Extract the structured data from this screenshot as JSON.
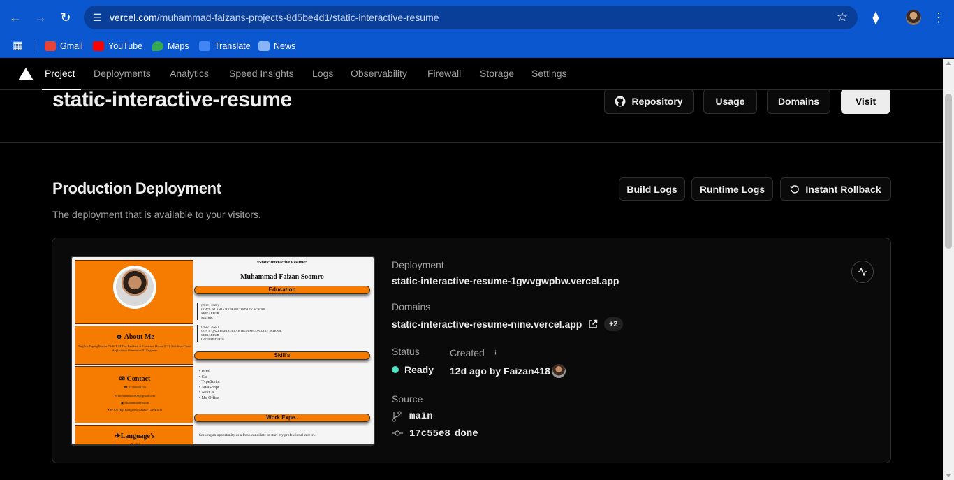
{
  "browser": {
    "url_host": "vercel.com",
    "url_path": "/muhammad-faizans-projects-8d5be4d1/static-interactive-resume",
    "bookmarks": [
      {
        "label": "Gmail",
        "color": "#ea4335"
      },
      {
        "label": "YouTube",
        "color": "#ff0000"
      },
      {
        "label": "Maps",
        "color": "#34a853"
      },
      {
        "label": "Translate",
        "color": "#4285f4"
      },
      {
        "label": "News",
        "color": "#8ab4f8"
      }
    ]
  },
  "nav": {
    "tabs": [
      "Project",
      "Deployments",
      "Analytics",
      "Speed Insights",
      "Logs",
      "Observability",
      "Firewall",
      "Storage",
      "Settings"
    ],
    "active": "Project"
  },
  "header": {
    "title": "static-interactive-resume",
    "buttons": {
      "repository": "Repository",
      "usage": "Usage",
      "domains": "Domains",
      "visit": "Visit"
    }
  },
  "production": {
    "title": "Production Deployment",
    "subtitle": "The deployment that is available to your visitors.",
    "buttons": {
      "build_logs": "Build Logs",
      "runtime_logs": "Runtime Logs",
      "instant_rollback": "Instant Rollback"
    }
  },
  "deployment": {
    "deployment_label": "Deployment",
    "deployment_url": "static-interactive-resume-1gwvgwpbw.vercel.app",
    "domains_label": "Domains",
    "domain_url": "static-interactive-resume-nine.vercel.app",
    "domain_extra": "+2",
    "status_label": "Status",
    "status_value": "Ready",
    "status_color": "#50e3c2",
    "created_label": "Created",
    "created_value": "12d ago by Faizan418",
    "source_label": "Source",
    "branch": "main",
    "commit": "17c55e8",
    "commit_message": "done"
  },
  "preview": {
    "page_title": "~Static Interactive Resume~",
    "name": "Muhammad Faizan Soomro",
    "about_heading": "About Me",
    "about_text": "English Typing Master 70-W P M The Bestknal at Governor House (I.T). Solidtive Cloud Application Generative AI Engineer",
    "contact_heading": "Contact",
    "contact_phone": "03700688159",
    "contact_email": "muhammad5000@gmail.com",
    "contact_name": "Muhammad Faizan",
    "contact_address": "B-305 Haji Bungalow's Malir-15 Karachi",
    "language_heading": "Language's",
    "language_item": "English",
    "education_bar": "Education",
    "edu_1": [
      "(2018 - 2020)",
      "GOVT: ISLAMIA HIGH SECONDARY SCHOOL",
      "SHIKARPUR",
      "MATRIC"
    ],
    "edu_2": [
      "(2020 - 2022)",
      "GOVT: QAZI HABIBULLAH HIGH SECONDARY SCHOOL",
      "SHIKARPUR",
      "INTERMEDIATE"
    ],
    "skills_bar": "Skill's",
    "skills": [
      "Html",
      "Css",
      "TypeScript",
      "JavaScript",
      "Next.Js",
      "Ms-Office"
    ],
    "work_bar": "Work Expe..",
    "work_text": "Seeking an opportunity as a fresh candidate to start my professional career..."
  }
}
